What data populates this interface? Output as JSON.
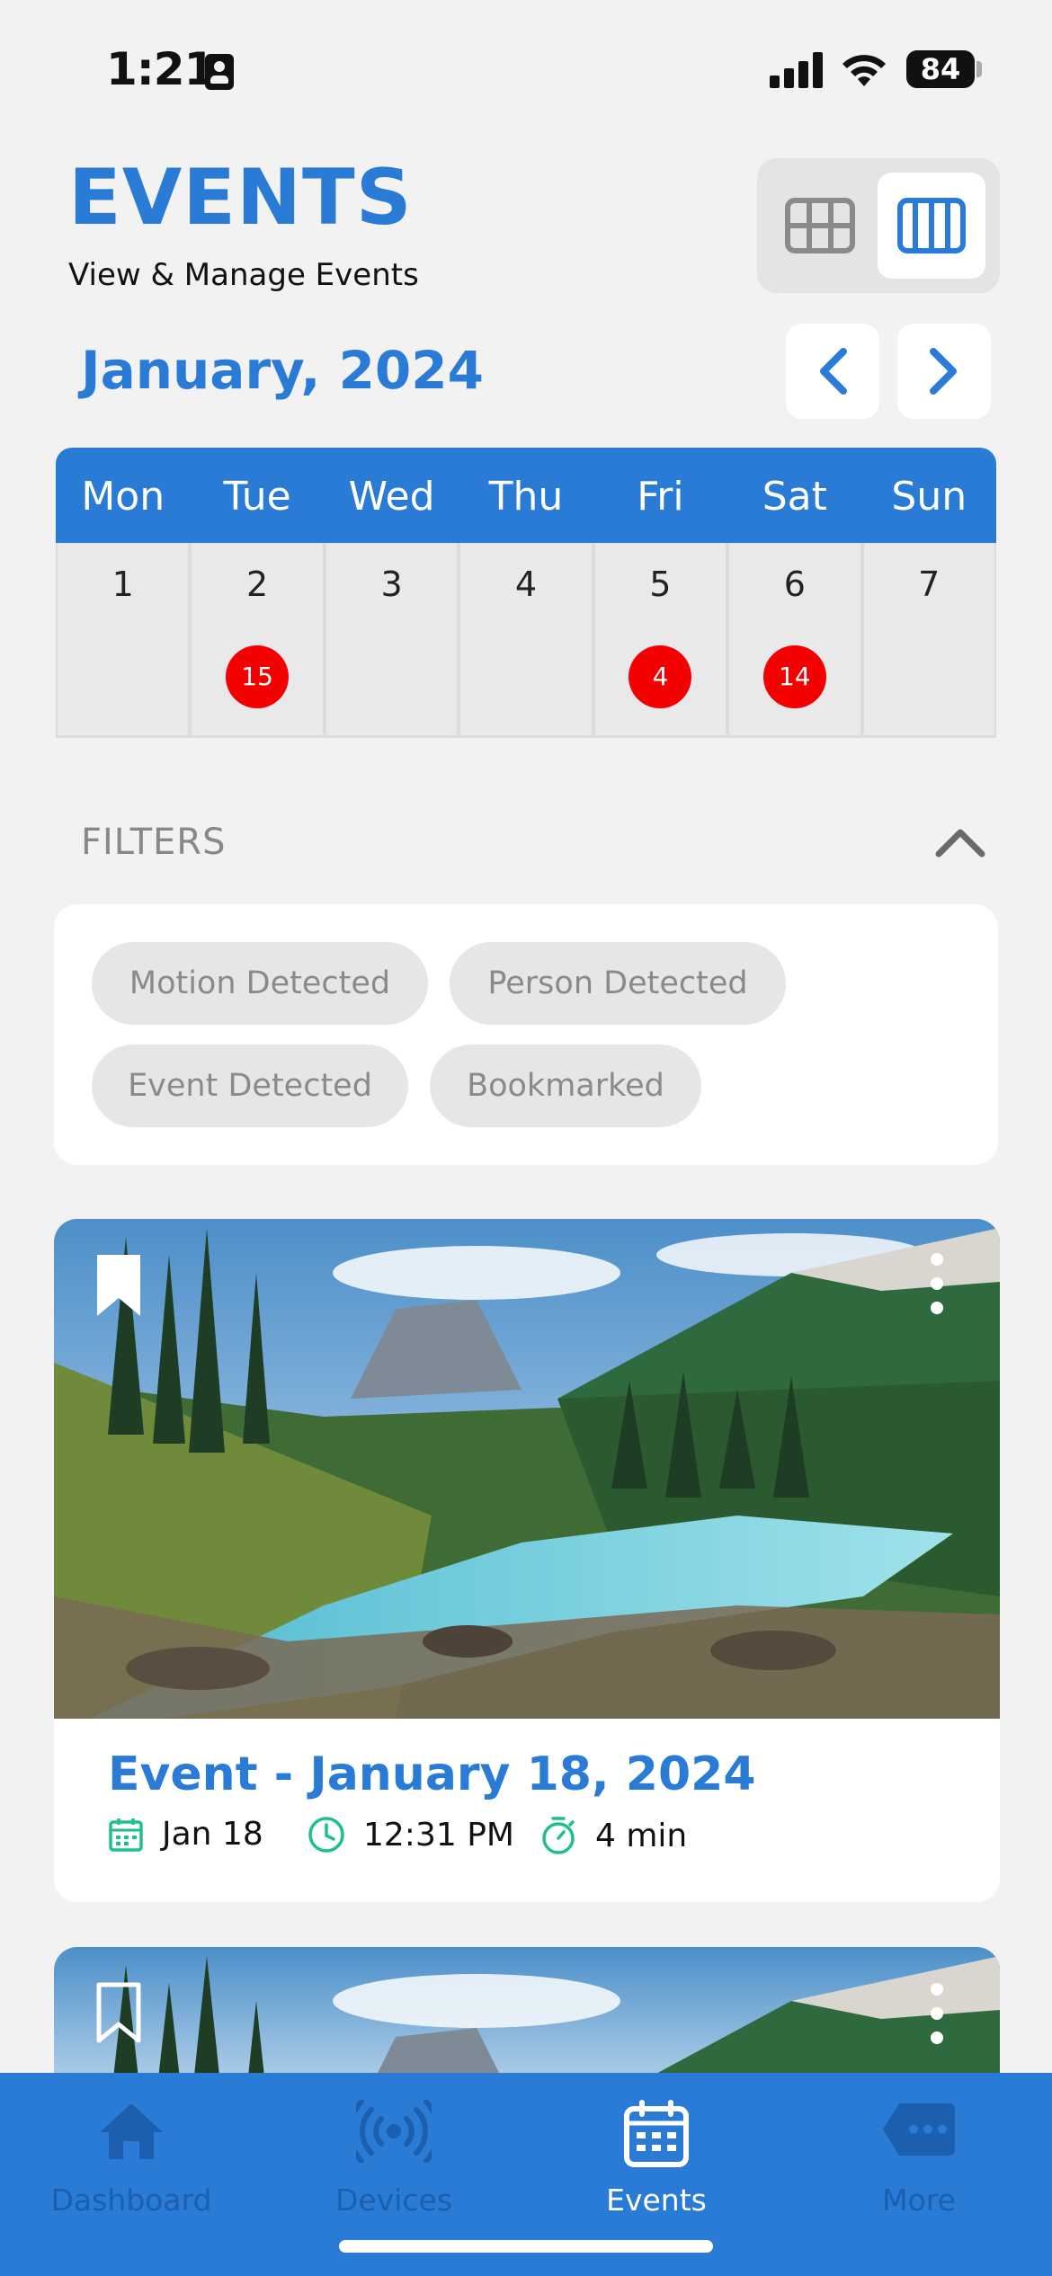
{
  "status_bar": {
    "time": "1:21",
    "battery": "84"
  },
  "header": {
    "title": "EVENTS",
    "subtitle": "View & Manage Events"
  },
  "calendar": {
    "month_label": "January, 2024",
    "weekdays": [
      "Mon",
      "Tue",
      "Wed",
      "Thu",
      "Fri",
      "Sat",
      "Sun"
    ],
    "days": [
      {
        "day": "1",
        "count": ""
      },
      {
        "day": "2",
        "count": "15"
      },
      {
        "day": "3",
        "count": ""
      },
      {
        "day": "4",
        "count": ""
      },
      {
        "day": "5",
        "count": "4"
      },
      {
        "day": "6",
        "count": "14"
      },
      {
        "day": "7",
        "count": ""
      }
    ]
  },
  "filters": {
    "label": "FILTERS",
    "chips": [
      "Motion Detected",
      "Person Detected",
      "Event Detected",
      "Bookmarked"
    ]
  },
  "events": [
    {
      "title": "Event - January 18, 2024",
      "date": "Jan 18",
      "time": "12:31 PM",
      "duration": "4 min",
      "bookmarked": true
    },
    {
      "title": "",
      "date": "",
      "time": "",
      "duration": "",
      "bookmarked": false
    }
  ],
  "tabbar": {
    "tabs": [
      {
        "label": "Dashboard",
        "icon": "home-icon"
      },
      {
        "label": "Devices",
        "icon": "broadcast-icon"
      },
      {
        "label": "Events",
        "icon": "calendar-icon",
        "active": true
      },
      {
        "label": "More",
        "icon": "more-tag-icon"
      }
    ]
  },
  "colors": {
    "accent": "#2a7bd6",
    "badge": "#f50000",
    "meta_icon": "#1ec08a"
  }
}
